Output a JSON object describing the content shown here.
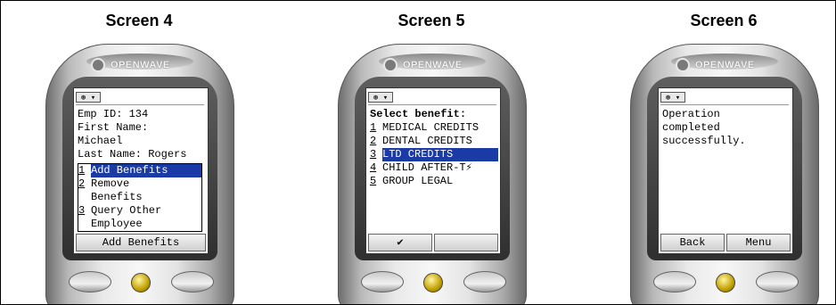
{
  "brand": "OPENWAVE",
  "menu_glyph": "⊛ ▾",
  "screens": [
    {
      "title": "Screen 4",
      "text_lines": [
        "Emp ID: 134",
        "First Name:",
        "Michael",
        "Last Name: Rogers"
      ],
      "menu": [
        {
          "num": "1",
          "lines": [
            "Add Benefits"
          ],
          "selected": true
        },
        {
          "num": "2",
          "lines": [
            "Remove",
            "Benefits"
          ],
          "selected": false
        },
        {
          "num": "3",
          "lines": [
            "Query Other",
            "Employee"
          ],
          "selected": false
        }
      ],
      "softkeys": [
        "Add Benefits"
      ]
    },
    {
      "title": "Screen 5",
      "heading": "Select benefit:",
      "menu": [
        {
          "num": "1",
          "label": "MEDICAL CREDITS",
          "selected": false
        },
        {
          "num": "2",
          "label": "DENTAL CREDITS",
          "selected": false
        },
        {
          "num": "3",
          "label": "LTD CREDITS",
          "selected": true
        },
        {
          "num": "4",
          "label": "CHILD AFTER-T⚡",
          "selected": false
        },
        {
          "num": "5",
          "label": "GROUP LEGAL",
          "selected": false
        }
      ],
      "softkeys": [
        "✔",
        ""
      ]
    },
    {
      "title": "Screen 6",
      "text_lines": [
        "Operation",
        "completed",
        "successfully."
      ],
      "softkeys": [
        "Back",
        "Menu"
      ]
    }
  ]
}
